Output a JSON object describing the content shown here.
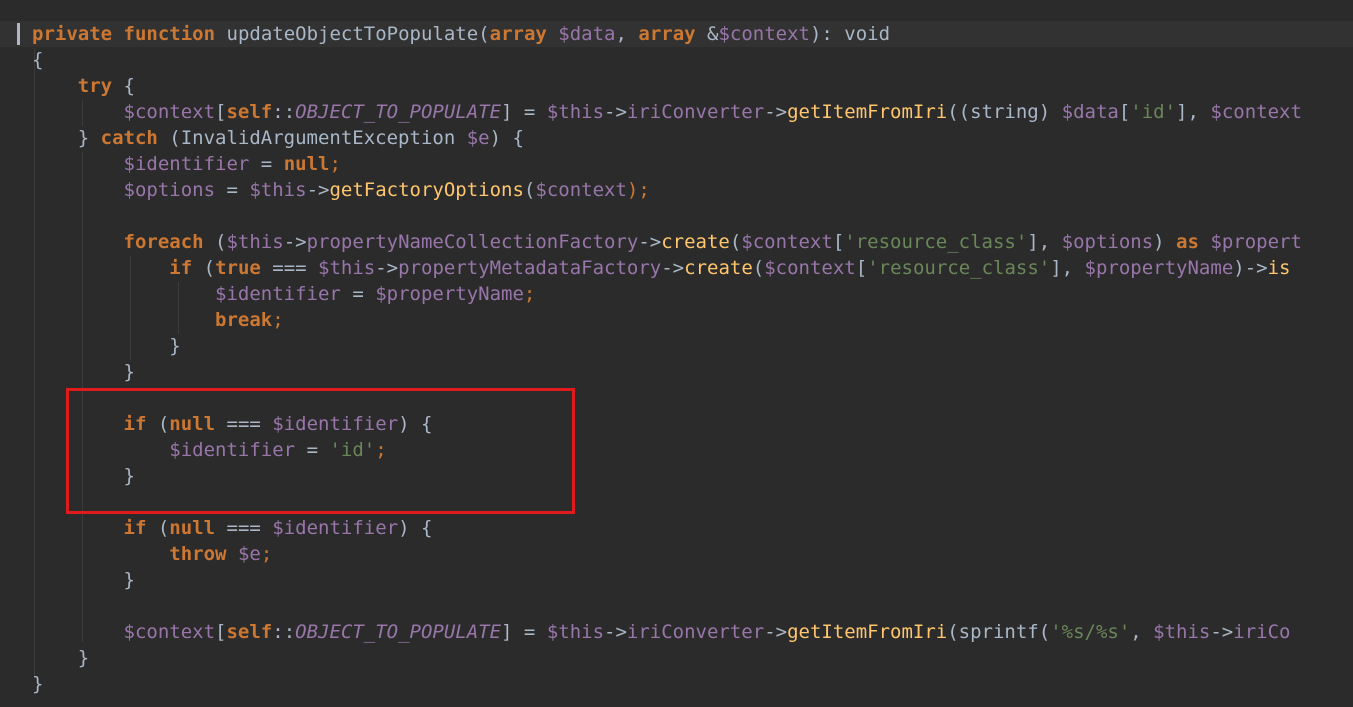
{
  "editor": {
    "language": "php",
    "highlight_color": "#e11b1b",
    "lines": [
      [
        {
          "t": "private",
          "c": "kw"
        },
        {
          "t": " ",
          "c": "pl"
        },
        {
          "t": "function",
          "c": "kw"
        },
        {
          "t": " ",
          "c": "pl"
        },
        {
          "t": "updateObjectToPopulate",
          "c": "pl"
        },
        {
          "t": "(",
          "c": "pl"
        },
        {
          "t": "array",
          "c": "kw"
        },
        {
          "t": " ",
          "c": "pl"
        },
        {
          "t": "$data",
          "c": "var"
        },
        {
          "t": ", ",
          "c": "pl"
        },
        {
          "t": "array",
          "c": "kw"
        },
        {
          "t": " &",
          "c": "pl"
        },
        {
          "t": "$context",
          "c": "var"
        },
        {
          "t": "): void",
          "c": "pl"
        }
      ],
      [
        {
          "t": "{",
          "c": "pl"
        }
      ],
      [
        {
          "t": "    ",
          "c": "pl"
        },
        {
          "t": "try",
          "c": "kw"
        },
        {
          "t": " {",
          "c": "pl"
        }
      ],
      [
        {
          "t": "        ",
          "c": "pl"
        },
        {
          "t": "$context",
          "c": "var"
        },
        {
          "t": "[",
          "c": "pl"
        },
        {
          "t": "self",
          "c": "kw"
        },
        {
          "t": "::",
          "c": "pl"
        },
        {
          "t": "OBJECT_TO_POPULATE",
          "c": "cst"
        },
        {
          "t": "] = ",
          "c": "pl"
        },
        {
          "t": "$this",
          "c": "var"
        },
        {
          "t": "->",
          "c": "pl"
        },
        {
          "t": "iriConverter",
          "c": "var"
        },
        {
          "t": "->",
          "c": "pl"
        },
        {
          "t": "getItemFromIri",
          "c": "fn"
        },
        {
          "t": "((string) ",
          "c": "pl"
        },
        {
          "t": "$data",
          "c": "var"
        },
        {
          "t": "[",
          "c": "pl"
        },
        {
          "t": "'id'",
          "c": "str"
        },
        {
          "t": "], ",
          "c": "pl"
        },
        {
          "t": "$context",
          "c": "var"
        }
      ],
      [
        {
          "t": "    } ",
          "c": "pl"
        },
        {
          "t": "catch",
          "c": "kw"
        },
        {
          "t": " (InvalidArgumentException ",
          "c": "pl"
        },
        {
          "t": "$e",
          "c": "var"
        },
        {
          "t": ") {",
          "c": "pl"
        }
      ],
      [
        {
          "t": "        ",
          "c": "pl"
        },
        {
          "t": "$identifier",
          "c": "var"
        },
        {
          "t": " = ",
          "c": "pl"
        },
        {
          "t": "null",
          "c": "kw"
        },
        {
          "t": ";",
          "c": "kwn"
        }
      ],
      [
        {
          "t": "        ",
          "c": "pl"
        },
        {
          "t": "$options",
          "c": "var"
        },
        {
          "t": " = ",
          "c": "pl"
        },
        {
          "t": "$this",
          "c": "var"
        },
        {
          "t": "->",
          "c": "pl"
        },
        {
          "t": "getFactoryOptions",
          "c": "fn"
        },
        {
          "t": "(",
          "c": "pl"
        },
        {
          "t": "$context",
          "c": "var"
        },
        {
          "t": ");",
          "c": "kwn"
        }
      ],
      [],
      [
        {
          "t": "        ",
          "c": "pl"
        },
        {
          "t": "foreach",
          "c": "kw"
        },
        {
          "t": " (",
          "c": "pl"
        },
        {
          "t": "$this",
          "c": "var"
        },
        {
          "t": "->",
          "c": "pl"
        },
        {
          "t": "propertyNameCollectionFactory",
          "c": "var"
        },
        {
          "t": "->",
          "c": "pl"
        },
        {
          "t": "create",
          "c": "fn"
        },
        {
          "t": "(",
          "c": "pl"
        },
        {
          "t": "$context",
          "c": "var"
        },
        {
          "t": "[",
          "c": "pl"
        },
        {
          "t": "'resource_class'",
          "c": "str"
        },
        {
          "t": "], ",
          "c": "pl"
        },
        {
          "t": "$options",
          "c": "var"
        },
        {
          "t": ") ",
          "c": "pl"
        },
        {
          "t": "as",
          "c": "kw"
        },
        {
          "t": " ",
          "c": "pl"
        },
        {
          "t": "$propert",
          "c": "var"
        }
      ],
      [
        {
          "t": "            ",
          "c": "pl"
        },
        {
          "t": "if",
          "c": "kw"
        },
        {
          "t": " (",
          "c": "pl"
        },
        {
          "t": "true",
          "c": "kw"
        },
        {
          "t": " === ",
          "c": "pl"
        },
        {
          "t": "$this",
          "c": "var"
        },
        {
          "t": "->",
          "c": "pl"
        },
        {
          "t": "propertyMetadataFactory",
          "c": "var"
        },
        {
          "t": "->",
          "c": "pl"
        },
        {
          "t": "create",
          "c": "fn"
        },
        {
          "t": "(",
          "c": "pl"
        },
        {
          "t": "$context",
          "c": "var"
        },
        {
          "t": "[",
          "c": "pl"
        },
        {
          "t": "'resource_class'",
          "c": "str"
        },
        {
          "t": "], ",
          "c": "pl"
        },
        {
          "t": "$propertyName",
          "c": "var"
        },
        {
          "t": ")->",
          "c": "pl"
        },
        {
          "t": "is",
          "c": "fn"
        }
      ],
      [
        {
          "t": "                ",
          "c": "pl"
        },
        {
          "t": "$identifier",
          "c": "var"
        },
        {
          "t": " = ",
          "c": "pl"
        },
        {
          "t": "$propertyName",
          "c": "var"
        },
        {
          "t": ";",
          "c": "kwn"
        }
      ],
      [
        {
          "t": "                ",
          "c": "pl"
        },
        {
          "t": "break",
          "c": "kw"
        },
        {
          "t": ";",
          "c": "kwn"
        }
      ],
      [
        {
          "t": "            }",
          "c": "pl"
        }
      ],
      [
        {
          "t": "        }",
          "c": "pl"
        }
      ],
      [],
      [
        {
          "t": "        ",
          "c": "pl"
        },
        {
          "t": "if",
          "c": "kw"
        },
        {
          "t": " (",
          "c": "pl"
        },
        {
          "t": "null",
          "c": "kw"
        },
        {
          "t": " === ",
          "c": "pl"
        },
        {
          "t": "$identifier",
          "c": "var"
        },
        {
          "t": ") {",
          "c": "pl"
        }
      ],
      [
        {
          "t": "            ",
          "c": "pl"
        },
        {
          "t": "$identifier",
          "c": "var"
        },
        {
          "t": " = ",
          "c": "pl"
        },
        {
          "t": "'id'",
          "c": "str"
        },
        {
          "t": ";",
          "c": "kwn"
        }
      ],
      [
        {
          "t": "        }",
          "c": "pl"
        }
      ],
      [],
      [
        {
          "t": "        ",
          "c": "pl"
        },
        {
          "t": "if",
          "c": "kw"
        },
        {
          "t": " (",
          "c": "pl"
        },
        {
          "t": "null",
          "c": "kw"
        },
        {
          "t": " === ",
          "c": "pl"
        },
        {
          "t": "$identifier",
          "c": "var"
        },
        {
          "t": ") {",
          "c": "pl"
        }
      ],
      [
        {
          "t": "            ",
          "c": "pl"
        },
        {
          "t": "throw",
          "c": "kw"
        },
        {
          "t": " ",
          "c": "pl"
        },
        {
          "t": "$e",
          "c": "var"
        },
        {
          "t": ";",
          "c": "kwn"
        }
      ],
      [
        {
          "t": "        }",
          "c": "pl"
        }
      ],
      [],
      [
        {
          "t": "        ",
          "c": "pl"
        },
        {
          "t": "$context",
          "c": "var"
        },
        {
          "t": "[",
          "c": "pl"
        },
        {
          "t": "self",
          "c": "kw"
        },
        {
          "t": "::",
          "c": "pl"
        },
        {
          "t": "OBJECT_TO_POPULATE",
          "c": "cst"
        },
        {
          "t": "] = ",
          "c": "pl"
        },
        {
          "t": "$this",
          "c": "var"
        },
        {
          "t": "->",
          "c": "pl"
        },
        {
          "t": "iriConverter",
          "c": "var"
        },
        {
          "t": "->",
          "c": "pl"
        },
        {
          "t": "getItemFromIri",
          "c": "fn"
        },
        {
          "t": "(sprintf(",
          "c": "pl"
        },
        {
          "t": "'%s/%s'",
          "c": "str"
        },
        {
          "t": ", ",
          "c": "pl"
        },
        {
          "t": "$this",
          "c": "var"
        },
        {
          "t": "->",
          "c": "pl"
        },
        {
          "t": "iriCo",
          "c": "var"
        }
      ],
      [
        {
          "t": "    }",
          "c": "pl"
        }
      ],
      [
        {
          "t": "}",
          "c": "pl"
        }
      ]
    ]
  }
}
